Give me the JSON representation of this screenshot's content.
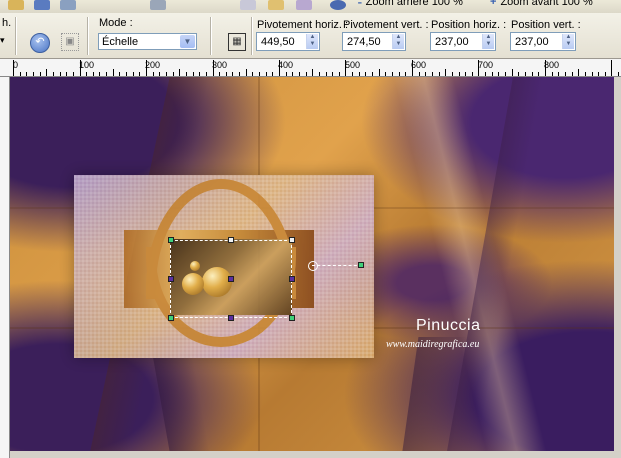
{
  "toolbar_top": {
    "zoom_out_label": "Zoom arrière 100 %",
    "zoom_in_label": "Zoom avant 100 %"
  },
  "options": {
    "truncated_label": "h. :",
    "mode_label": "Mode :",
    "mode_value": "Échelle",
    "pivot_h_label": "Pivotement horiz. :",
    "pivot_h_value": "449,50",
    "pivot_v_label": "Pivotement vert. :",
    "pivot_v_value": "274,50",
    "pos_h_label": "Position horiz. :",
    "pos_h_value": "237,00",
    "pos_v_label": "Position vert. :",
    "pos_v_value": "237,00"
  },
  "ruler": {
    "labels": [
      "0",
      "100",
      "200",
      "300",
      "400",
      "500",
      "600",
      "700",
      "800"
    ]
  },
  "canvas": {
    "watermark_name": "Pinuccia",
    "watermark_url": "www.maidiregrafica.eu"
  },
  "colors": {
    "purple": "#3b1f5a",
    "gold": "#e1a24c",
    "handle_green": "#3fd07a",
    "handle_purple": "#5a2fa0"
  }
}
